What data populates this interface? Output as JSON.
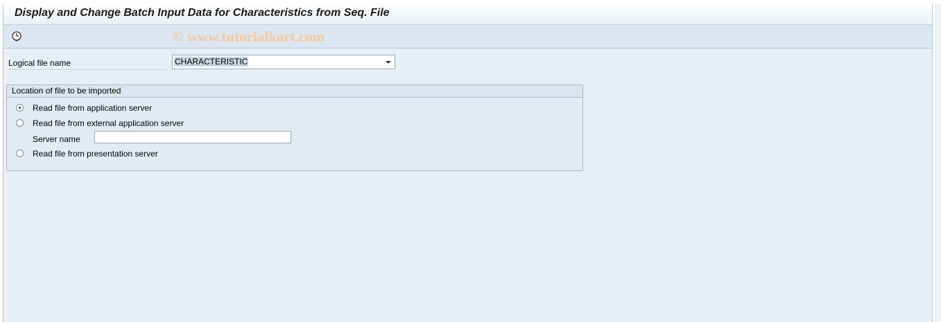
{
  "window": {
    "title": "Display and Change Batch Input Data for Characteristics from Seq. File"
  },
  "toolbar": {
    "execute_icon": "clock-execute-icon",
    "watermark": "© www.tutorialkart.com"
  },
  "form": {
    "logical_file_name_label": "Logical file name",
    "logical_file_name_value": "CHARACTERISTIC"
  },
  "location_group": {
    "title": "Location of file to be imported",
    "options": [
      {
        "label": "Read file from application server",
        "selected": true
      },
      {
        "label": "Read file from external application server",
        "selected": false
      },
      {
        "label": "Read file from presentation server",
        "selected": false
      }
    ],
    "server_name_label": "Server name",
    "server_name_value": ""
  }
}
